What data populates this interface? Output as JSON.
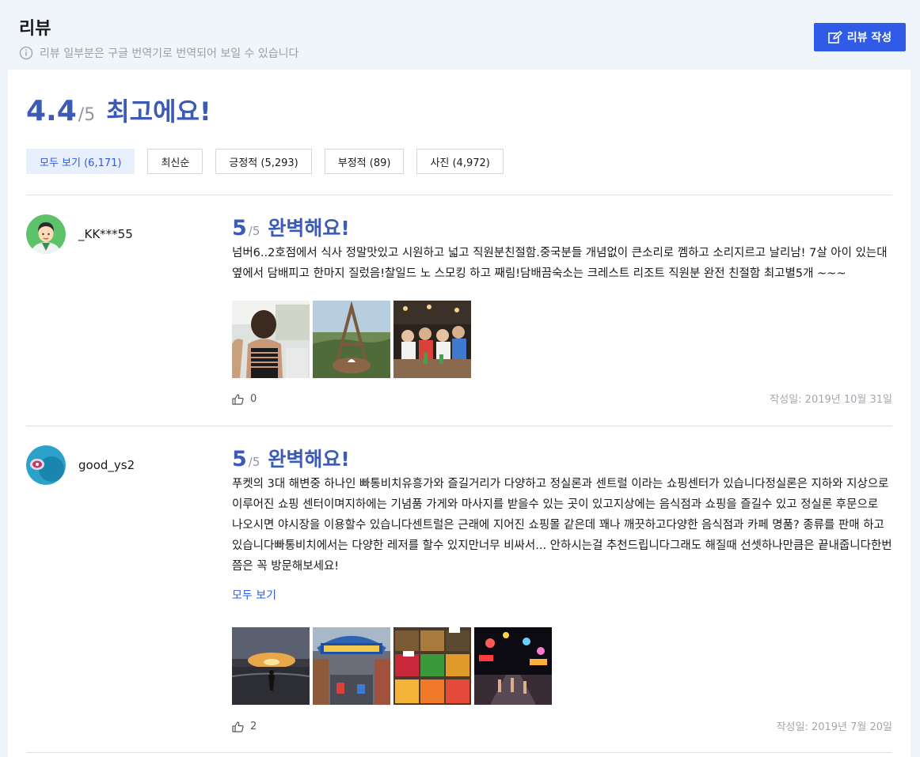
{
  "header": {
    "title": "리뷰",
    "notice": "리뷰 일부분은 구글 번역기로 번역되어 보일 수 있습니다",
    "write_button": "리뷰 작성"
  },
  "summary": {
    "score": "4.4",
    "out_of": "/5",
    "label": "최고에요!"
  },
  "filters": [
    {
      "label": "모두 보기 (6,171)",
      "active": true
    },
    {
      "label": "최신순",
      "active": false
    },
    {
      "label": "긍정적 (5,293)",
      "active": false
    },
    {
      "label": "부정적 (89)",
      "active": false
    },
    {
      "label": "사진 (4,972)",
      "active": false
    }
  ],
  "reviews": [
    {
      "user": "_KK***55",
      "score": "5",
      "out_of": "/5",
      "title": "완벽해요!",
      "text": "넘버6..2호점에서 식사 정말맛있고 시원하고 넓고 직원분친절함.중국분들 개념없이 큰소리로 껨하고 소리지르고 날리남! 7살 아이 있는대 옆에서 담배피고 한마지 질렀음!찰일드 노 스모킹 하고 째림!담배끔숙소는 크레스트 리조트 직원분 완전 친절함 최고별5개 ~~~",
      "likes": "0",
      "date": "작성일: 2019년 10월 31일"
    },
    {
      "user": "good_ys2",
      "score": "5",
      "out_of": "/5",
      "title": "완벽해요!",
      "text": "푸켓의 3대 해변중 하나인 빠통비치유흥가와 즐길거리가 다양하고 정실론과 센트럴 이라는 쇼핑센터가 있습니다정실론은 지하와 지상으로 이루어진 쇼핑 센터이며지하에는 기념품 가게와 마사지를 받을수 있는 곳이 있고지상에는 음식점과 쇼핑을 즐길수 있고 정실론 후문으로 나오시면 야시장을 이용할수 있습니다센트럴은 근래에 지어진 쇼핑몰 같은데 꽤나 깨끗하고다양한 음식점과 카페 명품? 종류를 판매 하고 있습니다빠통비치에서는 다양한 레저를 할수 있지만너무 비싸서... 안하시는걸 추천드립니다그래도 해질때 선셋하나만큼은 끝내줍니다한번쯤은 꼭 방문해보세요!",
      "more": "모두 보기",
      "likes": "2",
      "date": "작성일: 2019년 7월 20일"
    }
  ]
}
